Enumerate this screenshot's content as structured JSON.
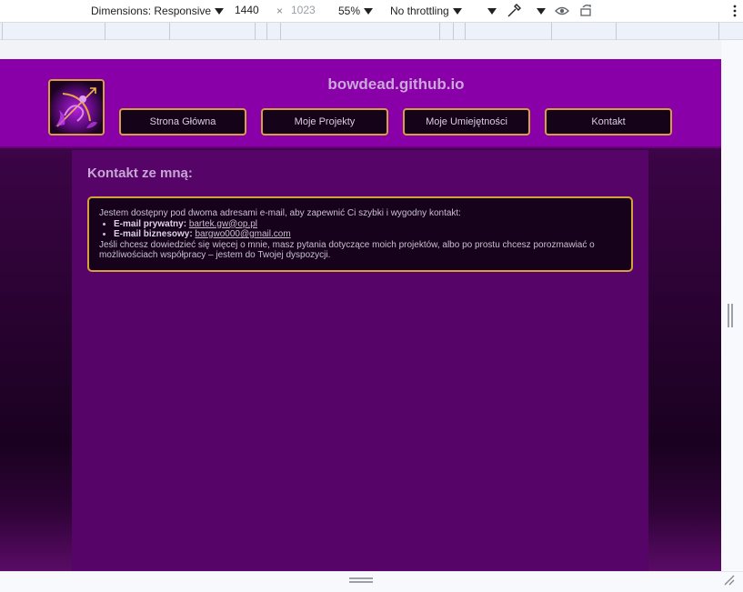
{
  "devtools": {
    "dimensions_label": "Dimensions: Responsive",
    "width_value": "1440",
    "times_sign": "×",
    "height_value": "1023",
    "zoom_label": "55%",
    "throttling_label": "No throttling",
    "icons": [
      "chevron-down-icon",
      "eyedropper-icon",
      "eye-icon",
      "rotate-icon",
      "more-vertical-icon"
    ]
  },
  "site": {
    "title": "bowdead.github.io",
    "nav": [
      {
        "label": "Strona Główna"
      },
      {
        "label": "Moje Projekty"
      },
      {
        "label": "Moje Umiejętności"
      },
      {
        "label": "Kontakt"
      }
    ],
    "contact": {
      "heading": "Kontakt ze mną:",
      "intro": "Jestem dostępny pod dwoma adresami e-mail, aby zapewnić Ci szybki i wygodny kontakt:",
      "emails": [
        {
          "label": "E-mail prywatny:",
          "value": "bartek.gw@op.pl"
        },
        {
          "label": "E-mail biznesowy:",
          "value": "bargwo000@gmail.com"
        }
      ],
      "outro": "Jeśli chcesz dowiedzieć się więcej o mnie, masz pytania dotyczące moich projektów, albo po prostu chcesz porozmawiać o możliwościach współpracy – jestem do Twojej dyspozycji."
    },
    "colors": {
      "header": "#8a00a8",
      "content_bg": "#560468",
      "gold_border": "#d5a13a",
      "button_bg": "#15031a"
    }
  }
}
